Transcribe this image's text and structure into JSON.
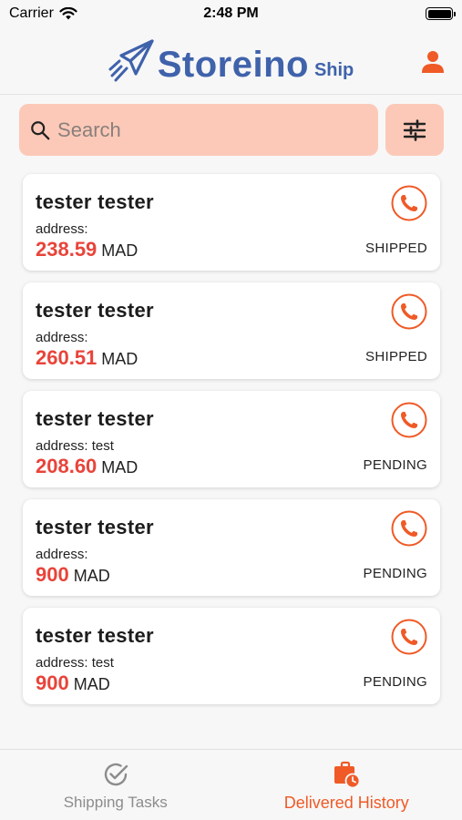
{
  "status_bar": {
    "carrier": "Carrier",
    "time": "2:48 PM"
  },
  "header": {
    "logo_text": "Storeino",
    "logo_sub": "Ship",
    "profile_icon": "person-icon"
  },
  "search": {
    "placeholder": "Search",
    "filter_icon": "sliders-icon"
  },
  "orders": [
    {
      "name": "tester tester",
      "address": "address:",
      "price": "238.59",
      "currency": "MAD",
      "status": "SHIPPED"
    },
    {
      "name": "tester tester",
      "address": "address:",
      "price": "260.51",
      "currency": "MAD",
      "status": "SHIPPED"
    },
    {
      "name": "tester tester",
      "address": "address: test",
      "price": "208.60",
      "currency": "MAD",
      "status": "PENDING"
    },
    {
      "name": "tester tester",
      "address": "address:",
      "price": "900",
      "currency": "MAD",
      "status": "PENDING"
    },
    {
      "name": "tester tester",
      "address": "address: test",
      "price": "900",
      "currency": "MAD",
      "status": "PENDING"
    }
  ],
  "tabs": [
    {
      "label": "Shipping Tasks",
      "icon": "check-circle-icon",
      "active": false
    },
    {
      "label": "Delivered History",
      "icon": "briefcase-clock-icon",
      "active": true
    }
  ],
  "colors": {
    "accent": "#ef5a26",
    "price": "#e8443a",
    "brand": "#3f62ab",
    "search_bg": "#fcc9b8"
  }
}
